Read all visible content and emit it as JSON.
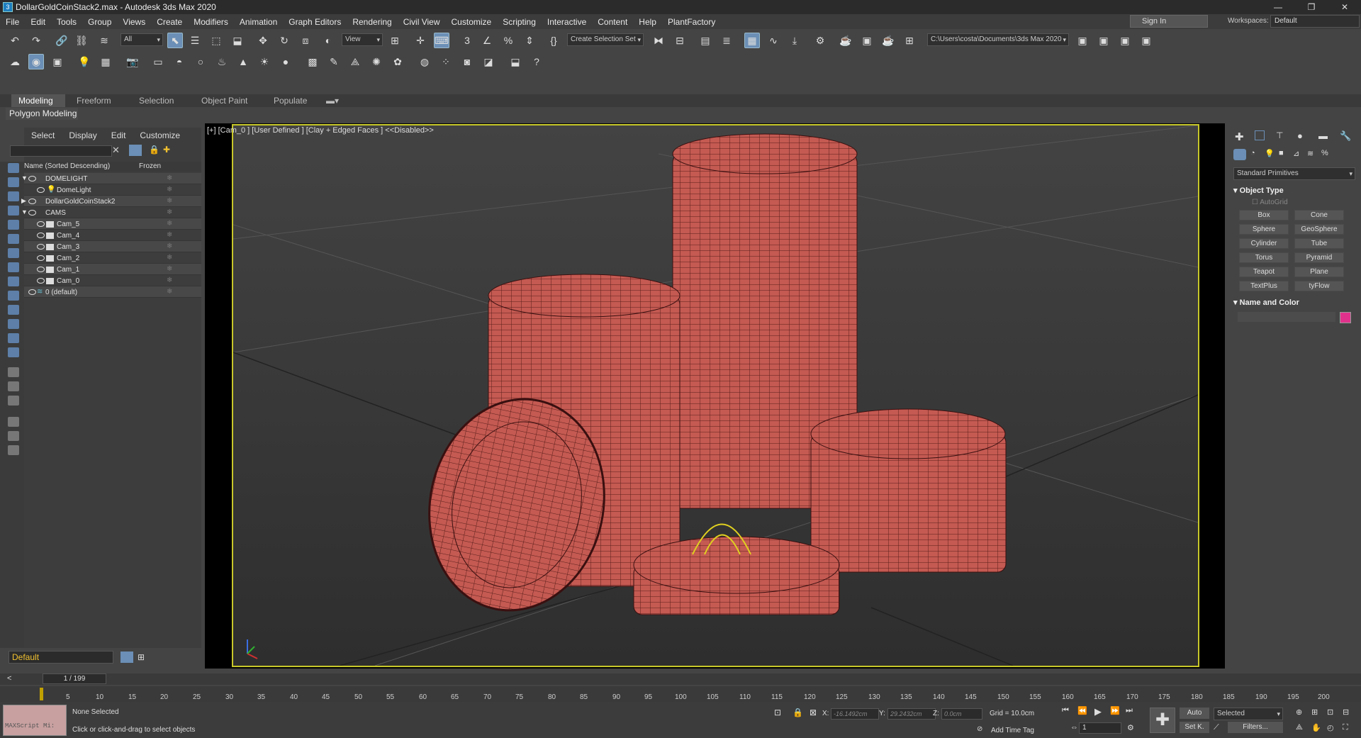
{
  "titlebar": {
    "title": "DollarGoldCoinStack2.max - Autodesk 3ds Max 2020",
    "minimize": "—",
    "maximize": "❐",
    "close": "✕"
  },
  "menubar": {
    "items": [
      "File",
      "Edit",
      "Tools",
      "Group",
      "Views",
      "Create",
      "Modifiers",
      "Animation",
      "Graph Editors",
      "Rendering",
      "Civil View",
      "Customize",
      "Scripting",
      "Interactive",
      "Content",
      "Help",
      "PlantFactory"
    ]
  },
  "signin": {
    "label": "Sign In"
  },
  "workspaces": {
    "label": "Workspaces:",
    "value": "Default"
  },
  "toolbar1": {
    "filter_value": "All",
    "refcoord_value": "View",
    "selection_set_value": "Create Selection Set",
    "project_path": "C:\\Users\\costa\\Documents\\3ds Max 2020"
  },
  "ribbon": {
    "tabs": [
      "Modeling",
      "Freeform",
      "Selection",
      "Object Paint",
      "Populate"
    ],
    "subtab": "Polygon Modeling"
  },
  "scene_explorer": {
    "tabs": [
      "Select",
      "Display",
      "Edit",
      "Customize"
    ],
    "col_name": "Name (Sorted Descending)",
    "col_frozen": "Frozen",
    "rows": [
      {
        "label": "DOMELIGHT"
      },
      {
        "label": "DomeLight"
      },
      {
        "label": "DollarGoldCoinStack2"
      },
      {
        "label": "CAMS"
      },
      {
        "label": "Cam_5"
      },
      {
        "label": "Cam_4"
      },
      {
        "label": "Cam_3"
      },
      {
        "label": "Cam_2"
      },
      {
        "label": "Cam_1"
      },
      {
        "label": "Cam_0"
      },
      {
        "label": "0 (default)"
      }
    ]
  },
  "layer": {
    "value": "Default"
  },
  "viewport": {
    "label": "[+] [Cam_0 ] [User Defined ] [Clay + Edged Faces ]  <<Disabled>>"
  },
  "command_panel": {
    "category": "Standard Primitives",
    "object_type_title": "Object Type",
    "autogrid": "AutoGrid",
    "buttons": [
      "Box",
      "Cone",
      "Sphere",
      "GeoSphere",
      "Cylinder",
      "Tube",
      "Torus",
      "Pyramid",
      "Teapot",
      "Plane",
      "TextPlus",
      "tyFlow"
    ],
    "name_color_title": "Name and Color",
    "swatch_color": "#e0328c"
  },
  "timeslider": {
    "frames": "1 / 199",
    "prev": "<",
    "next": ">"
  },
  "timeline": {
    "ticks": [
      "5",
      "10",
      "15",
      "20",
      "25",
      "30",
      "35",
      "40",
      "45",
      "50",
      "55",
      "60",
      "65",
      "70",
      "75",
      "80",
      "85",
      "90",
      "95",
      "100",
      "105",
      "110",
      "115",
      "120",
      "125",
      "130",
      "135",
      "140",
      "145",
      "150",
      "155",
      "160",
      "165",
      "170",
      "175",
      "180",
      "185",
      "190",
      "195",
      "200"
    ]
  },
  "status": {
    "maxscript": "MAXScript Mi:",
    "selection": "None Selected",
    "prompt": "Click or click-and-drag to select objects",
    "x_label": "X:",
    "x_value": "-16.1492cm",
    "y_label": "Y:",
    "y_value": "29.2432cm",
    "z_label": "Z:",
    "z_value": "0.0cm",
    "grid": "Grid = 10.0cm",
    "add_time_tag": "Add Time Tag",
    "auto": "Auto",
    "setk": "Set K.",
    "key_mode": "Selected",
    "filters": "Filters...",
    "frame": "1"
  },
  "colors": {
    "accent": "#6b8fb6",
    "coin": "#c45a52",
    "viewport_border": "#c7c72a"
  }
}
